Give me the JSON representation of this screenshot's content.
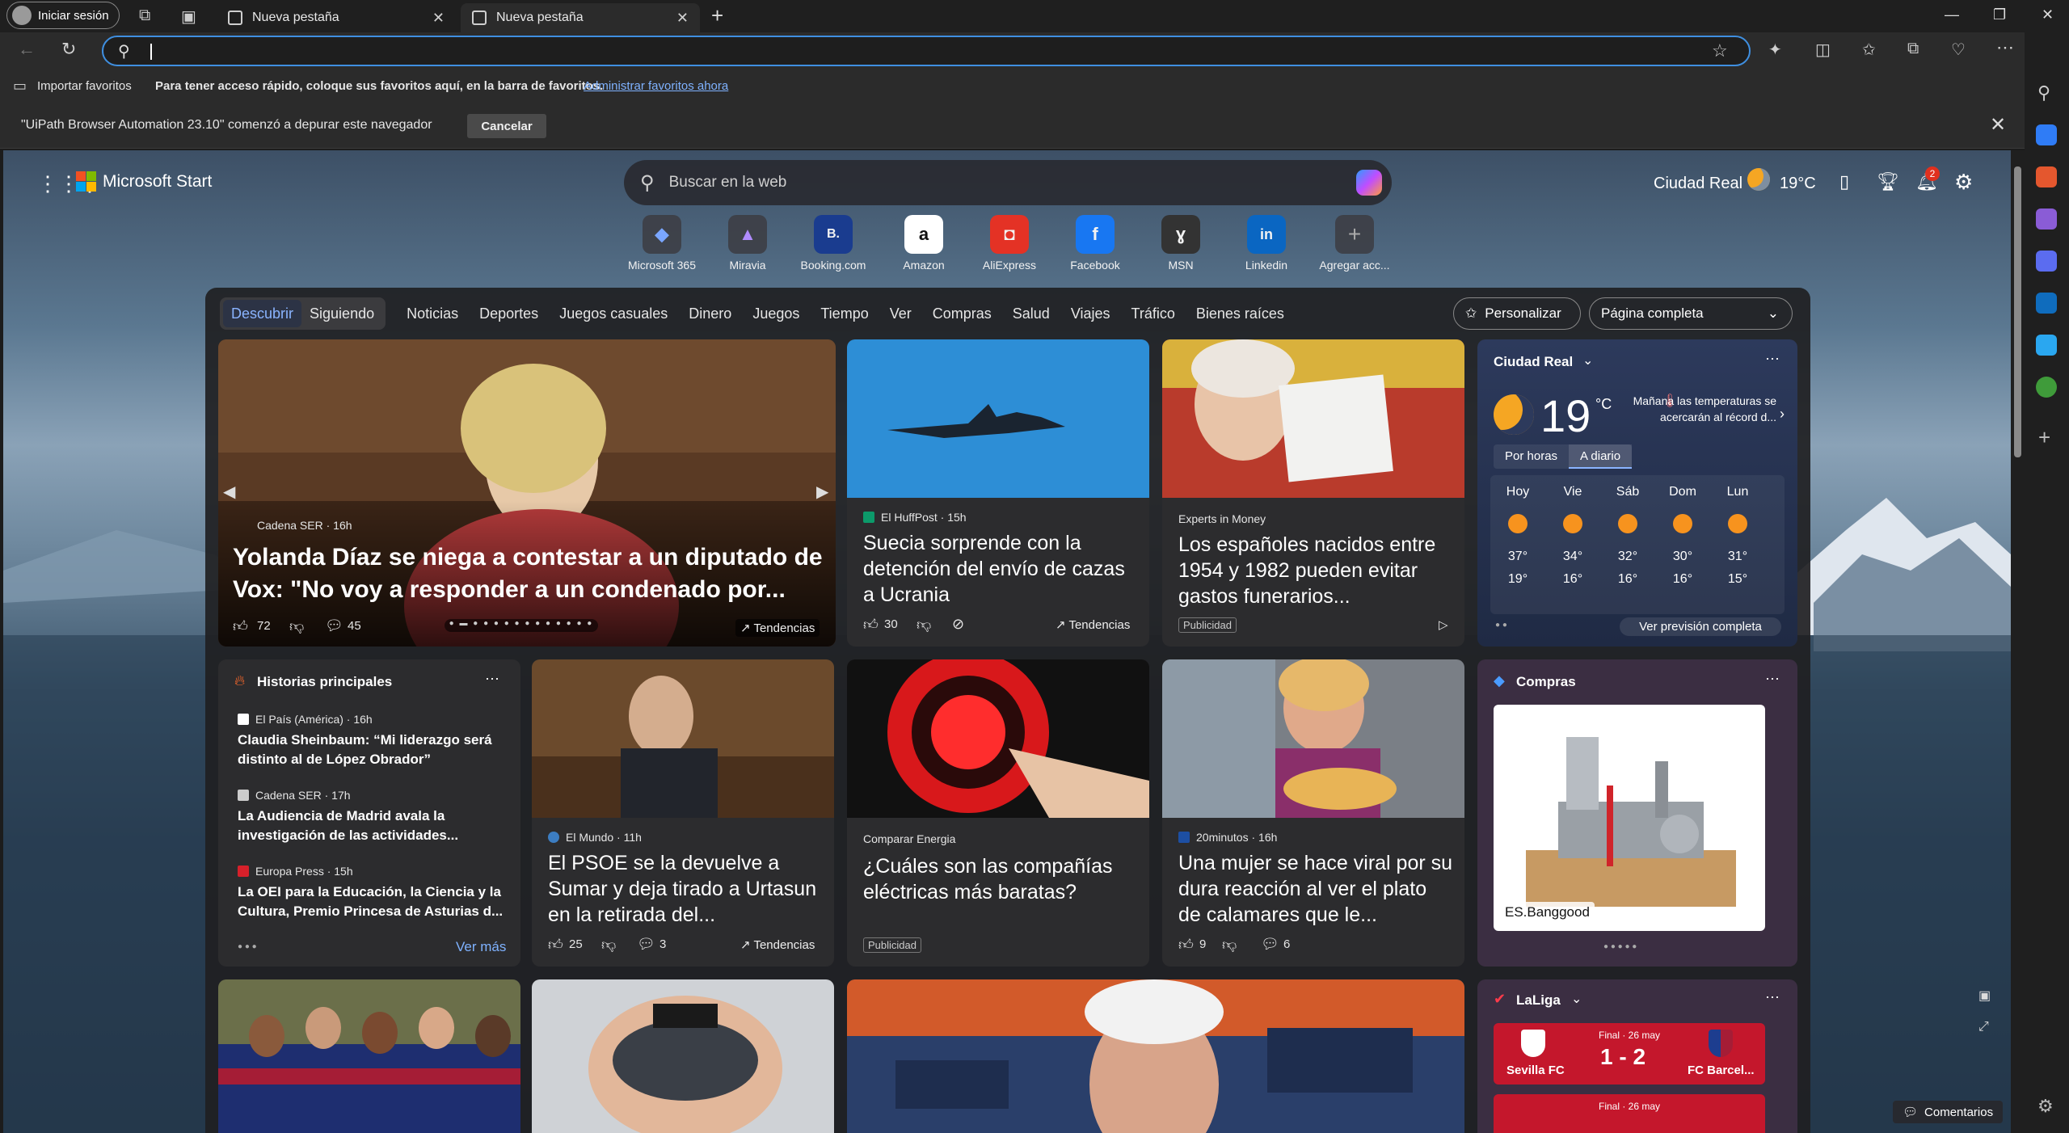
{
  "browser": {
    "signin_label": "Iniciar sesión",
    "tabs": [
      {
        "label": "Nueva pestaña"
      },
      {
        "label": "Nueva pestaña"
      }
    ],
    "address_value": "",
    "favbar": {
      "import": "Importar favoritos",
      "hint": "Para tener acceso rápido, coloque sus favoritos aquí, en la barra de favoritos.",
      "manage": "Administrar favoritos ahora"
    },
    "debug": {
      "message": "\"UiPath Browser Automation 23.10\" comenzó a depurar este navegador",
      "cancel": "Cancelar"
    }
  },
  "header": {
    "brand": "Microsoft Start",
    "search_placeholder": "Buscar en la web",
    "location": "Ciudad Real",
    "temp": "19°C",
    "notif_count": "2"
  },
  "quicklinks": [
    {
      "label": "Microsoft 365",
      "icon": "m365-icon",
      "glyph": "◆"
    },
    {
      "label": "Miravia",
      "icon": "miravia-icon",
      "glyph": "▲"
    },
    {
      "label": "Booking.com",
      "icon": "booking-icon",
      "glyph": "B."
    },
    {
      "label": "Amazon",
      "icon": "amazon-icon",
      "glyph": "a"
    },
    {
      "label": "AliExpress",
      "icon": "aliexpress-icon",
      "glyph": "◘"
    },
    {
      "label": "Facebook",
      "icon": "facebook-icon",
      "glyph": "f"
    },
    {
      "label": "MSN",
      "icon": "msn-icon",
      "glyph": "ɣ"
    },
    {
      "label": "Linkedin",
      "icon": "linkedin-icon",
      "glyph": "in"
    },
    {
      "label": "Agregar acc...",
      "icon": "add-icon",
      "glyph": "+"
    }
  ],
  "nav": {
    "tabs": [
      "Descubrir",
      "Siguiendo"
    ],
    "items": [
      "Noticias",
      "Deportes",
      "Juegos casuales",
      "Dinero",
      "Juegos",
      "Tiempo",
      "Ver",
      "Compras",
      "Salud",
      "Viajes",
      "Tráfico",
      "Bienes raíces"
    ],
    "personalize": "Personalizar",
    "layout": "Página completa"
  },
  "hero": {
    "source": "Cadena SER · 16h",
    "title": "Yolanda Díaz se niega a contestar a un diputado de Vox: \"No voy a responder a un condenado por...",
    "likes": "72",
    "comments": "45",
    "trend": "Tendencias"
  },
  "card2": {
    "source": "El HuffPost · 15h",
    "title": "Suecia sorprende con la detención del envío de cazas a Ucrania",
    "likes": "30",
    "trend": "Tendencias"
  },
  "card3": {
    "source": "Experts in Money",
    "title": "Los españoles nacidos entre 1954 y 1982 pueden evitar gastos funerarios...",
    "badge": "Publicidad"
  },
  "weather": {
    "city": "Ciudad Real",
    "temp": "19",
    "unit": "°C",
    "alert": "Mañana las temperaturas se acercarán al récord d...",
    "tabs": [
      "Por horas",
      "A diario"
    ],
    "days": [
      {
        "d": "Hoy",
        "hi": "37°",
        "lo": "19°"
      },
      {
        "d": "Vie",
        "hi": "34°",
        "lo": "16°"
      },
      {
        "d": "Sáb",
        "hi": "32°",
        "lo": "16°"
      },
      {
        "d": "Dom",
        "hi": "30°",
        "lo": "16°"
      },
      {
        "d": "Lun",
        "hi": "31°",
        "lo": "15°"
      }
    ],
    "more": "Ver previsión completa"
  },
  "top": {
    "title": "Historias principales",
    "items": [
      {
        "src": "El País (América) · 16h",
        "title": "Claudia Sheinbaum: “Mi liderazgo será distinto al de López Obrador”"
      },
      {
        "src": "Cadena SER · 17h",
        "title": "La Audiencia de Madrid avala la investigación de las actividades..."
      },
      {
        "src": "Europa Press · 15h",
        "title": "La OEI para la Educación, la Ciencia y la Cultura, Premio Princesa de Asturias d..."
      }
    ],
    "more": "Ver más"
  },
  "card5": {
    "source": "El Mundo · 11h",
    "title": "El PSOE se la devuelve a Sumar y deja tirado a Urtasun en la retirada del...",
    "likes": "25",
    "comments": "3",
    "trend": "Tendencias"
  },
  "card6": {
    "source": "Comparar Energia",
    "title": "¿Cuáles son las compañías eléctricas más baratas?",
    "badge": "Publicidad"
  },
  "card7": {
    "source": "20minutos · 16h",
    "title": "Una mujer se hace viral por su dura reacción al ver el plato de calamares que le...",
    "likes": "9",
    "comments": "6"
  },
  "shopping": {
    "title": "Compras",
    "store": "ES.Banggood"
  },
  "laliga": {
    "title": "LaLiga",
    "match": {
      "status": "Final · 26 may",
      "home": "Sevilla FC",
      "score": "1 - 2",
      "away": "FC Barcel..."
    },
    "next_status": "Final · 26 may"
  },
  "feedback": "Comentarios"
}
